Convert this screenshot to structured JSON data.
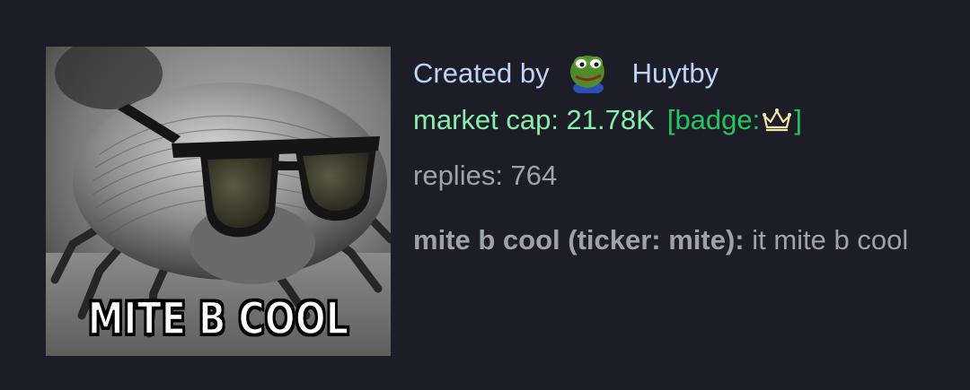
{
  "token": {
    "image_alt": "mite b cool token image",
    "image_caption": "MITE B COOL",
    "created_label": "Created by",
    "creator_name": "Huytby",
    "creator_avatar_icon": "pepe-frog-avatar-icon",
    "market_cap": "market cap: 21.78K",
    "badge_open": "[badge:",
    "badge_icon": "crown-icon",
    "badge_close": "]",
    "replies": "replies: 764",
    "name_ticker": "mite b cool (ticker: mite):",
    "description": "it mite b cool"
  },
  "colors": {
    "background": "#1c1d26",
    "created_text": "#bdd3f7",
    "market_cap_text": "#86efac",
    "badge_text": "#22c55e",
    "muted_text": "#9ca3af"
  }
}
